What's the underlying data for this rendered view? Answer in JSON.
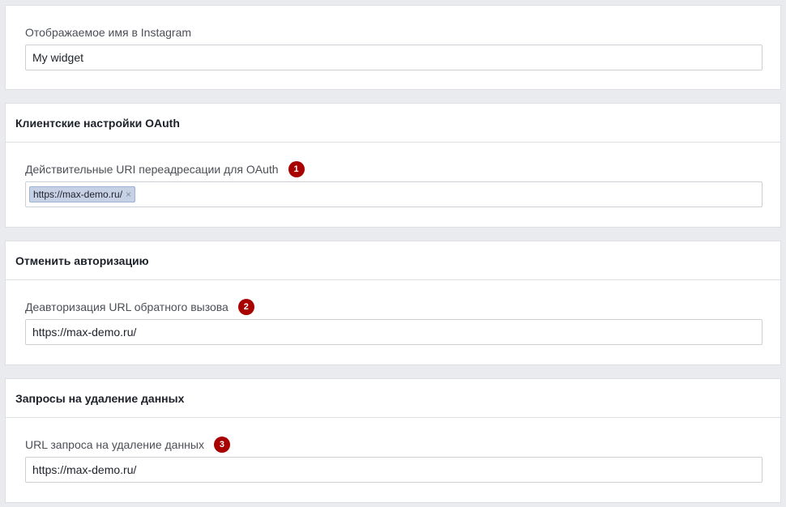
{
  "display_name": {
    "label": "Отображаемое имя в Instagram",
    "value": "My widget"
  },
  "oauth": {
    "title": "Клиентские настройки OAuth",
    "redirect_label": "Действительные URI переадресации для OAuth",
    "badge": "1",
    "tokens": [
      {
        "text": "https://max-demo.ru/",
        "remove": "×"
      }
    ]
  },
  "deauth": {
    "title": "Отменить авторизацию",
    "callback_label": "Деавторизация URL обратного вызова",
    "badge": "2",
    "value": "https://max-demo.ru/"
  },
  "data_deletion": {
    "title": "Запросы на удаление данных",
    "request_label": "URL запроса на удаление данных",
    "badge": "3",
    "value": "https://max-demo.ru/"
  }
}
